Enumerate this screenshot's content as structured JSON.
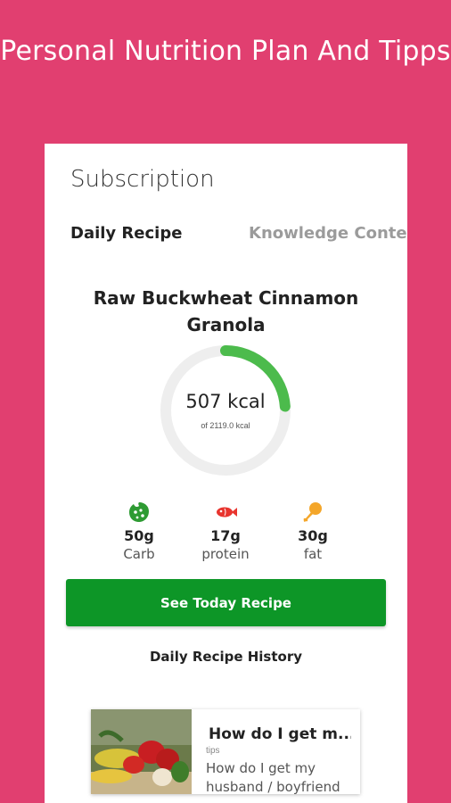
{
  "promo": {
    "title": "Personal Nutrition Plan And Tipps"
  },
  "screen": {
    "title": "Subscription",
    "tabs": [
      {
        "label": "Daily Recipe",
        "active": true
      },
      {
        "label": "Knowledge Conten",
        "active": false
      }
    ]
  },
  "recipe": {
    "name": "Raw Buckwheat Cinnamon Granola",
    "kcal_label": "507 kcal",
    "kcal_of_label": "of 2119.0 kcal",
    "kcal": 507,
    "kcal_goal": 2119.0,
    "macros": [
      {
        "value": "50g",
        "label": "Carb",
        "icon": "cookie-icon"
      },
      {
        "value": "17g",
        "label": "protein",
        "icon": "fish-icon"
      },
      {
        "value": "30g",
        "label": "fat",
        "icon": "drumstick-icon"
      }
    ],
    "cta_label": "See Today Recipe",
    "history_label": "Daily Recipe History"
  },
  "article": {
    "title": "How do I get m...",
    "tag": "tips",
    "excerpt": "How do I get my husband / boyfriend"
  },
  "colors": {
    "background": "#e13f70",
    "accent_green": "#0d9627",
    "ring_green": "#4cbb4c",
    "ring_track": "#eeeeee",
    "icon_green": "#2e9b33",
    "icon_red": "#e8342e",
    "icon_orange": "#f4a62a"
  }
}
